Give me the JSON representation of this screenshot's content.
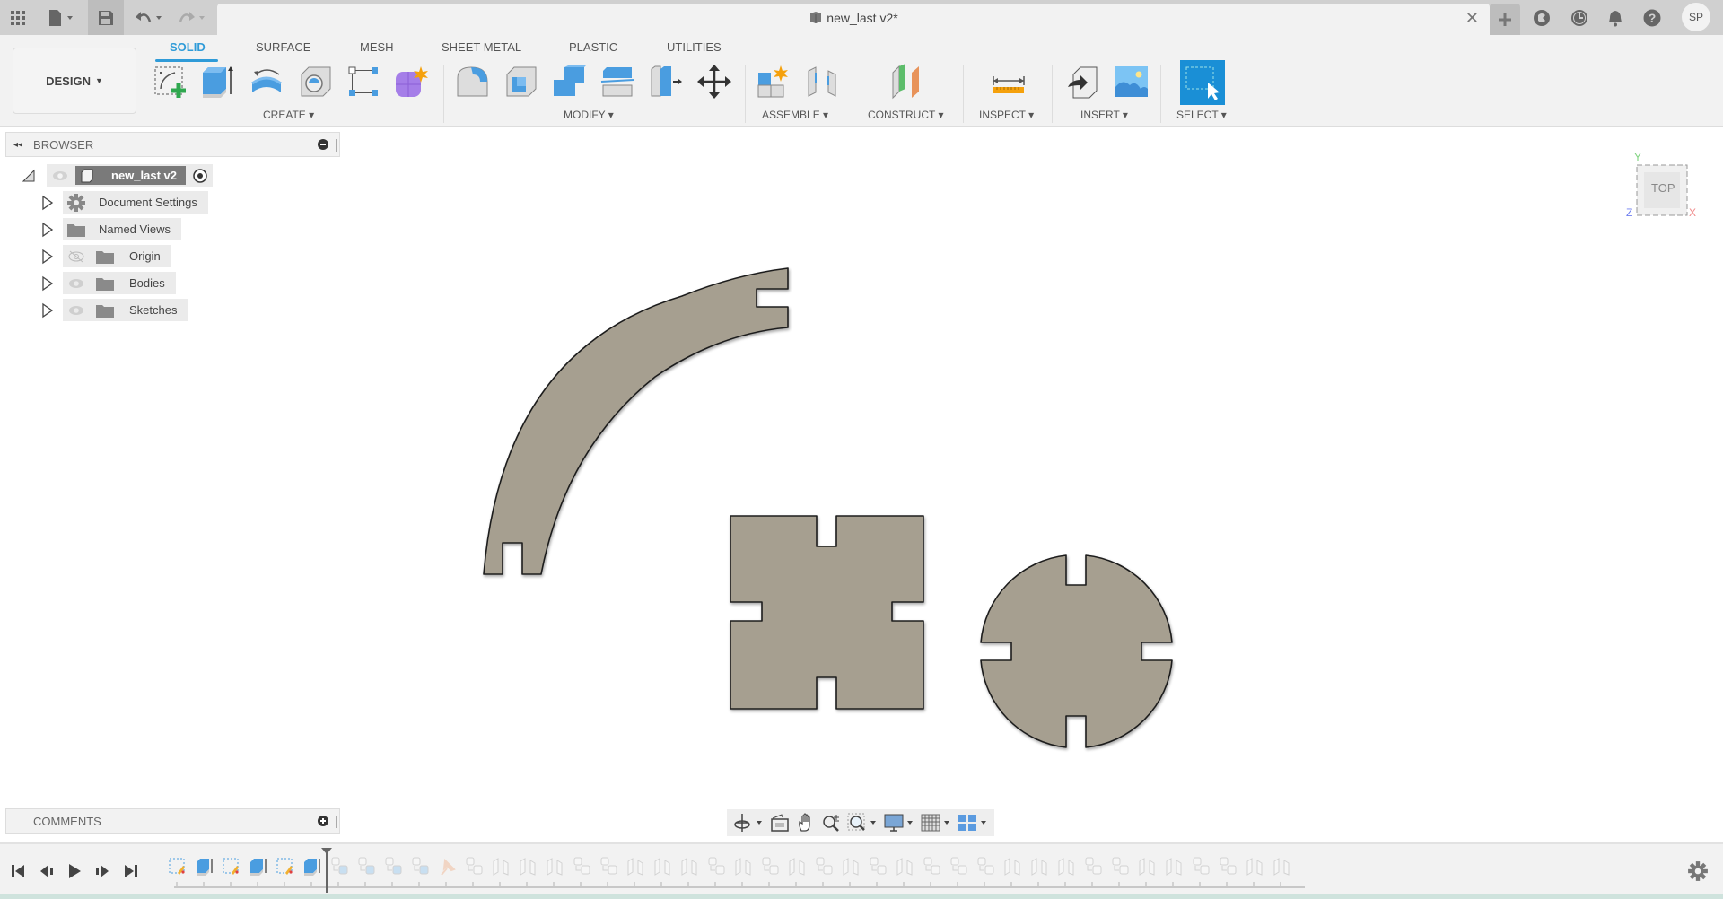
{
  "titlebar": {
    "document_title": "new_last v2*",
    "user_initials": "SP",
    "icons": [
      "apps-grid-icon",
      "file-icon",
      "save-icon",
      "undo-icon",
      "redo-icon",
      "close-icon",
      "new-tab-icon",
      "extensions-icon",
      "job-status-icon",
      "notifications-icon",
      "help-icon"
    ]
  },
  "workspace": {
    "label": "DESIGN"
  },
  "tabs": [
    {
      "label": "SOLID",
      "active": true
    },
    {
      "label": "SURFACE",
      "active": false
    },
    {
      "label": "MESH",
      "active": false
    },
    {
      "label": "SHEET METAL",
      "active": false
    },
    {
      "label": "PLASTIC",
      "active": false
    },
    {
      "label": "UTILITIES",
      "active": false
    }
  ],
  "groups": {
    "create": "CREATE",
    "modify": "MODIFY",
    "assemble": "ASSEMBLE",
    "construct": "CONSTRUCT",
    "inspect": "INSPECT",
    "insert": "INSERT",
    "select": "SELECT"
  },
  "browser": {
    "title": "BROWSER",
    "root": "new_last v2",
    "items": [
      {
        "label": "Document Settings",
        "icon": "gear-icon",
        "visibility": null
      },
      {
        "label": "Named Views",
        "icon": "folder-icon",
        "visibility": null
      },
      {
        "label": "Origin",
        "icon": "folder-icon",
        "visibility": "hidden"
      },
      {
        "label": "Bodies",
        "icon": "folder-icon",
        "visibility": "visible"
      },
      {
        "label": "Sketches",
        "icon": "folder-icon",
        "visibility": "visible"
      }
    ]
  },
  "comments": {
    "title": "COMMENTS"
  },
  "viewcube": {
    "face": "TOP",
    "axes": {
      "x": "X",
      "y": "Y",
      "z": "Z"
    }
  },
  "colors": {
    "accent": "#2f9bd8",
    "body_fill": "#a69f90",
    "body_edge": "#1e1e1e",
    "select_blue": "#1a8fd6"
  },
  "timeline": {
    "active_features": [
      "sketch",
      "extrude",
      "sketch",
      "extrude",
      "sketch",
      "extrude"
    ],
    "suppressed_features": [
      "component",
      "component",
      "component",
      "component",
      "pin",
      "component",
      "joint",
      "joint",
      "joint",
      "component",
      "component",
      "joint",
      "joint",
      "joint",
      "component",
      "joint",
      "component",
      "joint",
      "component",
      "joint",
      "component",
      "joint",
      "component",
      "component",
      "component",
      "joint",
      "joint",
      "joint",
      "component",
      "component",
      "joint",
      "joint",
      "component",
      "component",
      "joint",
      "joint"
    ]
  }
}
